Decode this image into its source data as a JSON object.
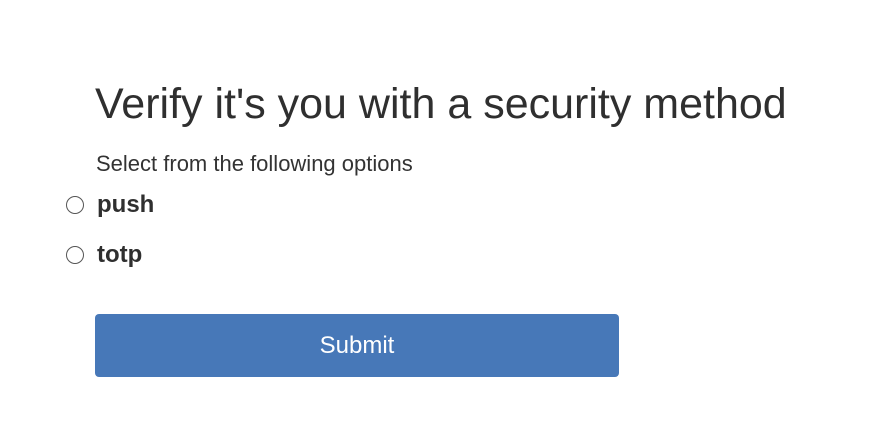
{
  "page": {
    "title": "Verify it's you with a security method",
    "subtitle": "Select from the following options"
  },
  "options": [
    {
      "label": "push",
      "selected": false
    },
    {
      "label": "totp",
      "selected": false
    }
  ],
  "actions": {
    "submit_label": "Submit"
  },
  "colors": {
    "accent": "#4778b8",
    "text": "#333333",
    "background": "#ffffff"
  }
}
